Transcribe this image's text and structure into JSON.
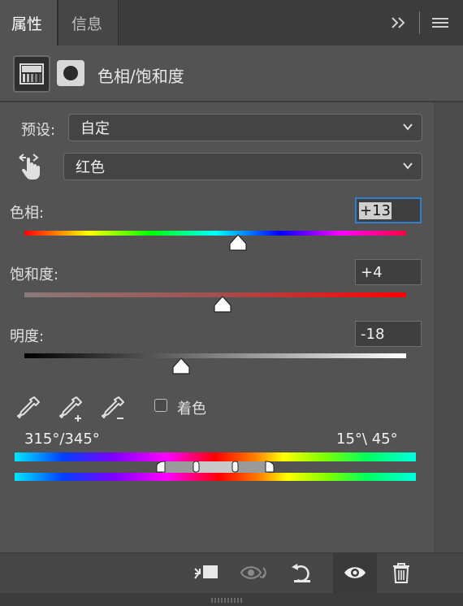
{
  "tabs": {
    "active": "属性",
    "inactive": "信息"
  },
  "header": {
    "title": "色相/饱和度"
  },
  "preset": {
    "label": "预设:",
    "value": "自定"
  },
  "channel": {
    "value": "红色"
  },
  "sliders": {
    "hue": {
      "label": "色相:",
      "value": "+13",
      "position": 0.56
    },
    "saturation": {
      "label": "饱和度:",
      "value": "+4",
      "position": 0.52
    },
    "lightness": {
      "label": "明度:",
      "value": "-18",
      "position": 0.41
    }
  },
  "colorize": {
    "label": "着色",
    "checked": false
  },
  "range": {
    "left": "315°/345°",
    "right": "15°\\ 45°"
  },
  "icons": {
    "panel_menu_expand": "double-chevron-right-icon",
    "panel_menu": "hamburger-menu-icon",
    "adjustment": "hue-saturation-adjustment-icon",
    "mask": "layer-mask-icon",
    "on_image": "targeted-adjustment-hand-icon",
    "eyedropper": "eyedropper-icon",
    "eyedropper_add": "eyedropper-plus-icon",
    "eyedropper_subtract": "eyedropper-minus-icon",
    "clip": "clip-to-layer-icon",
    "view_previous": "view-previous-state-icon",
    "reset": "reset-icon",
    "visibility": "eye-icon",
    "delete": "trash-icon"
  },
  "colors": {
    "accent": "#2f7fd0",
    "panel_bg": "#535353",
    "tab_bg": "#3c3c3c"
  }
}
